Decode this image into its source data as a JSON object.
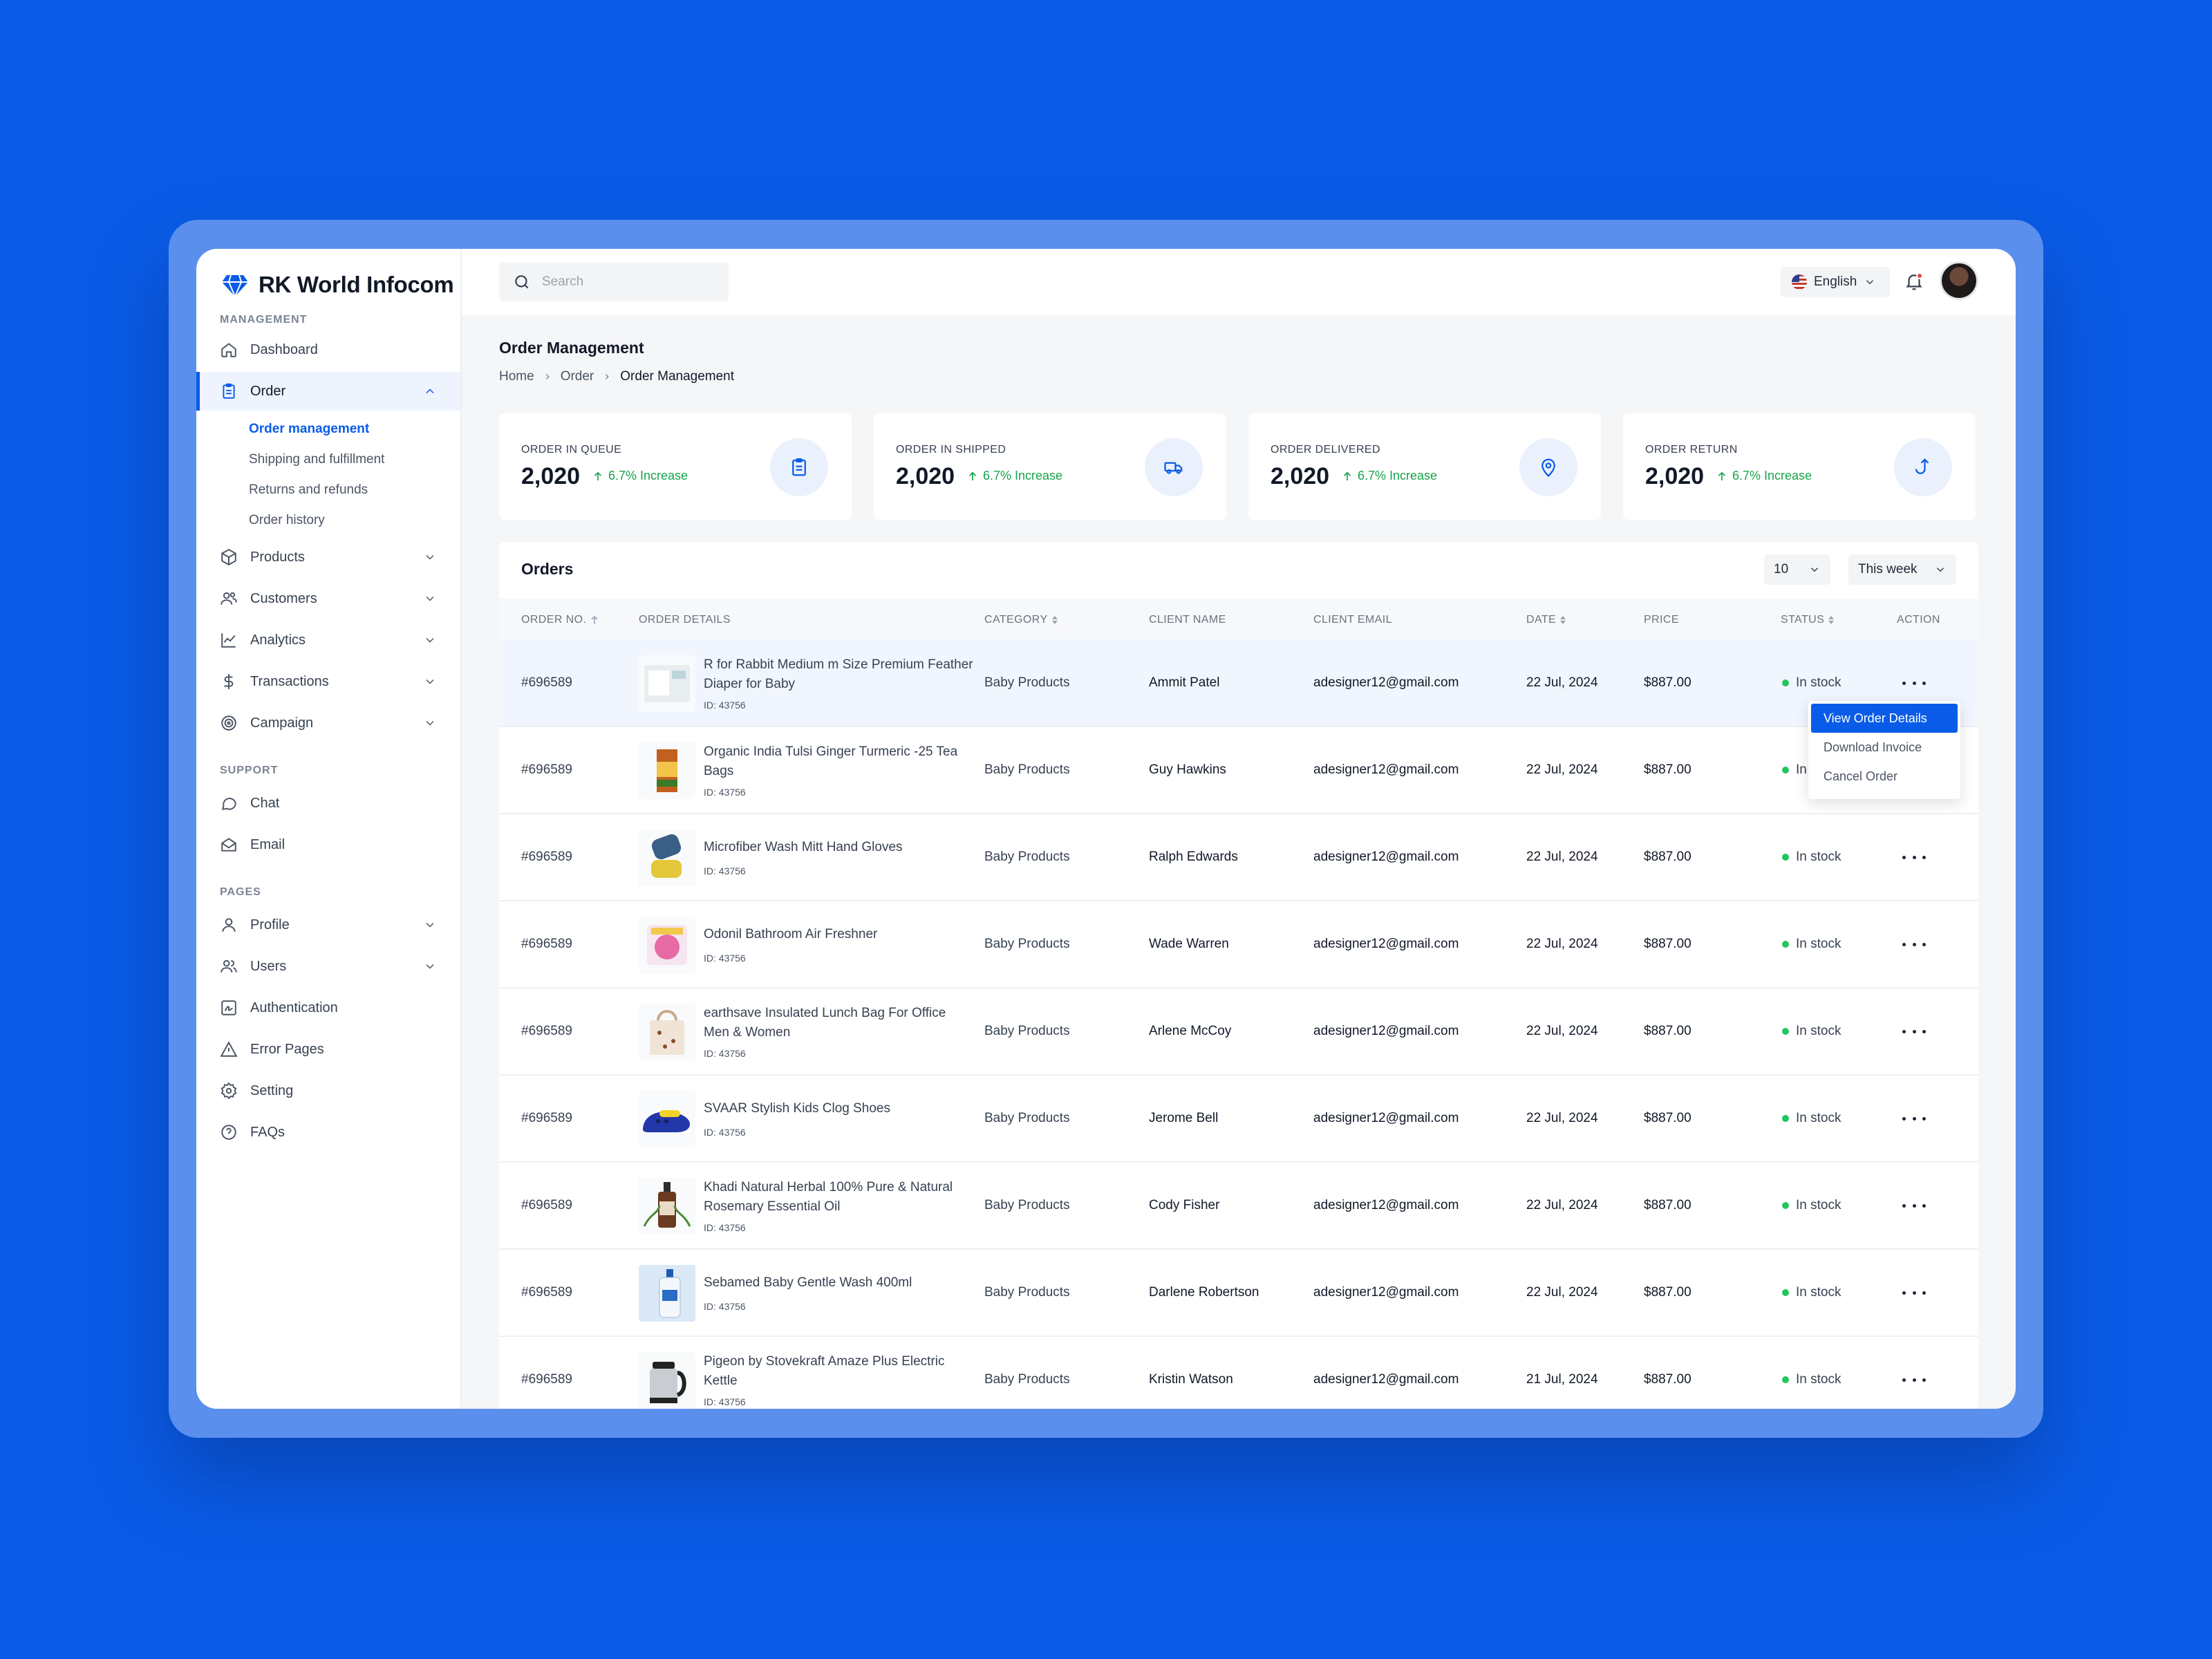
{
  "brand": {
    "name": "RK World Infocom",
    "accent": "#0a5ce8"
  },
  "sidebar": {
    "management_label": "MANAGEMENT",
    "support_label": "SUPPORT",
    "pages_label": "PAGES",
    "dashboard": "Dashboard",
    "order": "Order",
    "order_sub": [
      "Order management",
      "Shipping and fulfillment",
      "Returns and refunds",
      "Order history"
    ],
    "products": "Products",
    "customers": "Customers",
    "analytics": "Analytics",
    "transactions": "Transactions",
    "campaign": "Campaign",
    "chat": "Chat",
    "email": "Email",
    "profile": "Profile",
    "users": "Users",
    "authentication": "Authentication",
    "error_pages": "Error Pages",
    "setting": "Setting",
    "faqs": "FAQs"
  },
  "topbar": {
    "search_placeholder": "Search",
    "language": "English"
  },
  "page": {
    "title": "Order Management",
    "breadcrumb": [
      "Home",
      "Order",
      "Order Management"
    ]
  },
  "stats": [
    {
      "label": "ORDER IN QUEUE",
      "value": "2,020",
      "trend": "6.7% Increase",
      "icon": "clipboard-icon"
    },
    {
      "label": "ORDER IN SHIPPED",
      "value": "2,020",
      "trend": "6.7% Increase",
      "icon": "truck-icon"
    },
    {
      "label": "ORDER DELIVERED",
      "value": "2,020",
      "trend": "6.7% Increase",
      "icon": "location-pin-icon"
    },
    {
      "label": "ORDER RETURN",
      "value": "2,020",
      "trend": "6.7% Increase",
      "icon": "return-arrow-icon"
    }
  ],
  "orders": {
    "title": "Orders",
    "page_size": "10",
    "range": "This week",
    "columns": [
      "ORDER NO.",
      "ORDER DETAILS",
      "CATEGORY",
      "CLIENT NAME",
      "CLIENT EMAIL",
      "DATE",
      "PRICE",
      "STATUS",
      "ACTION"
    ],
    "rows": [
      {
        "no": "#696589",
        "product": "R for Rabbit Medium m Size Premium Feather Diaper for Baby",
        "pid": "ID: 43756",
        "category": "Baby Products",
        "client": "Ammit Patel",
        "email": "adesigner12@gmail.com",
        "date": "22 Jul, 2024",
        "price": "$887.00",
        "status": "In stock"
      },
      {
        "no": "#696589",
        "product": "Organic India Tulsi Ginger Turmeric -25 Tea Bags",
        "pid": "ID: 43756",
        "category": "Baby Products",
        "client": "Guy Hawkins",
        "email": "adesigner12@gmail.com",
        "date": "22 Jul, 2024",
        "price": "$887.00",
        "status": "In stock"
      },
      {
        "no": "#696589",
        "product": "Microfiber Wash Mitt Hand Gloves",
        "pid": "ID: 43756",
        "category": "Baby Products",
        "client": "Ralph Edwards",
        "email": "adesigner12@gmail.com",
        "date": "22 Jul, 2024",
        "price": "$887.00",
        "status": "In stock"
      },
      {
        "no": "#696589",
        "product": "Odonil Bathroom Air Freshner",
        "pid": "ID: 43756",
        "category": "Baby Products",
        "client": "Wade Warren",
        "email": "adesigner12@gmail.com",
        "date": "22 Jul, 2024",
        "price": "$887.00",
        "status": "In stock"
      },
      {
        "no": "#696589",
        "product": "earthsave Insulated Lunch Bag For Office Men & Women",
        "pid": "ID: 43756",
        "category": "Baby Products",
        "client": "Arlene McCoy",
        "email": "adesigner12@gmail.com",
        "date": "22 Jul, 2024",
        "price": "$887.00",
        "status": "In stock"
      },
      {
        "no": "#696589",
        "product": "SVAAR Stylish Kids Clog Shoes",
        "pid": "ID: 43756",
        "category": "Baby Products",
        "client": "Jerome Bell",
        "email": "adesigner12@gmail.com",
        "date": "22 Jul, 2024",
        "price": "$887.00",
        "status": "In stock"
      },
      {
        "no": "#696589",
        "product": "Khadi Natural Herbal 100% Pure & Natural Rosemary Essential Oil",
        "pid": "ID: 43756",
        "category": "Baby Products",
        "client": "Cody Fisher",
        "email": "adesigner12@gmail.com",
        "date": "22 Jul, 2024",
        "price": "$887.00",
        "status": "In stock"
      },
      {
        "no": "#696589",
        "product": "Sebamed Baby Gentle Wash 400ml",
        "pid": "ID: 43756",
        "category": "Baby Products",
        "client": "Darlene Robertson",
        "email": "adesigner12@gmail.com",
        "date": "22 Jul, 2024",
        "price": "$887.00",
        "status": "In stock"
      },
      {
        "no": "#696589",
        "product": "Pigeon by Stovekraft Amaze Plus Electric Kettle",
        "pid": "ID: 43756",
        "category": "Baby Products",
        "client": "Kristin Watson",
        "email": "adesigner12@gmail.com",
        "date": "21 Jul, 2024",
        "price": "$887.00",
        "status": "In stock"
      }
    ]
  },
  "action_menu": {
    "items": [
      "View Order Details",
      "Download Invoice",
      "Cancel Order"
    ]
  },
  "colors": {
    "background": "#0a5ce8",
    "status_ok": "#22c55e",
    "trend_up": "#16a34a"
  }
}
